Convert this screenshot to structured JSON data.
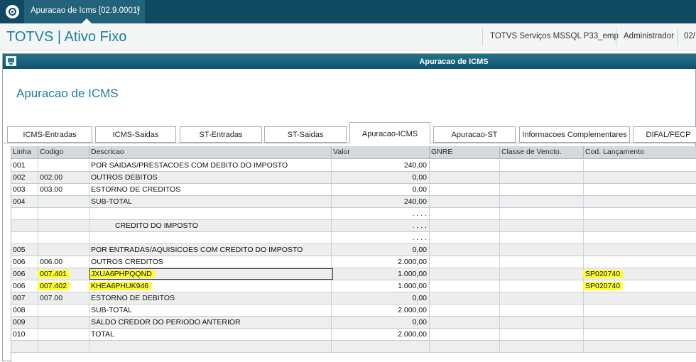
{
  "topbar": {
    "tab_title": "Apuracao de Icms [02.9.0001]",
    "tab_close": "×"
  },
  "header": {
    "app_title": "TOTVS | Ativo Fixo",
    "environment": "TOTVS Serviços MSSQL P33_emp",
    "user": "Administrador",
    "date": "02/"
  },
  "window": {
    "title": "Apuracao de ICMS",
    "page_title": "Apuracao de ICMS"
  },
  "tabs": [
    {
      "label": "ICMS-Entradas"
    },
    {
      "label": "ICMS-Saidas"
    },
    {
      "label": "ST-Entradas"
    },
    {
      "label": "ST-Saidas"
    },
    {
      "label": "Apuracao-ICMS",
      "selected": true
    },
    {
      "label": "Apuracao-ST"
    },
    {
      "label": "Informacoes Complementares"
    },
    {
      "label": "DIFAL/FECP"
    }
  ],
  "grid": {
    "columns": [
      "Linha",
      "Codigo",
      "Descricao",
      "Valor",
      "GNRE",
      "Classe de Vencto.",
      "Cod. Lançamento"
    ],
    "rows": [
      {
        "linha": "001",
        "codigo": "",
        "descricao": "POR SAIDAS/PRESTACOES COM DEBITO DO IMPOSTO",
        "valor": "240,00",
        "cod_lanc": ""
      },
      {
        "linha": "002",
        "codigo": "002.00",
        "descricao": "OUTROS DEBITOS",
        "valor": "0,00",
        "cod_lanc": ""
      },
      {
        "linha": "003",
        "codigo": "003.00",
        "descricao": "ESTORNO DE CREDITOS",
        "valor": "0,00",
        "cod_lanc": ""
      },
      {
        "linha": "004",
        "codigo": "",
        "descricao": "SUB-TOTAL",
        "valor": "240,00",
        "cod_lanc": ""
      },
      {
        "linha": "",
        "codigo": "",
        "descricao": "",
        "valor": ". . . .",
        "cod_lanc": ""
      },
      {
        "linha": "",
        "codigo": "",
        "descricao": "CREDITO DO IMPOSTO",
        "valor": ". . . .",
        "cod_lanc": "",
        "centered": true
      },
      {
        "linha": "",
        "codigo": "",
        "descricao": "",
        "valor": ". . . .",
        "cod_lanc": ""
      },
      {
        "linha": "005",
        "codigo": "",
        "descricao": "POR ENTRADAS/AQUISICOES COM CREDITO DO IMPOSTO",
        "valor": "0,00",
        "cod_lanc": ""
      },
      {
        "linha": "006",
        "codigo": "006.00",
        "descricao": "OUTROS CREDITOS",
        "valor": "2.000,00",
        "cod_lanc": ""
      },
      {
        "linha": "006",
        "codigo": "007.401",
        "descricao": "JXUA6PHPQQND",
        "valor": "1.000,00",
        "cod_lanc": "SP020740",
        "highlight": true,
        "focused": true
      },
      {
        "linha": "006",
        "codigo": "007.402",
        "descricao": "KHEA6PHUK946",
        "valor": "1.000,00",
        "cod_lanc": "SP020740",
        "highlight": true
      },
      {
        "linha": "007",
        "codigo": "007.00",
        "descricao": "ESTORNO DE DEBITOS",
        "valor": "0,00",
        "cod_lanc": ""
      },
      {
        "linha": "008",
        "codigo": "",
        "descricao": "SUB-TOTAL",
        "valor": "2.000,00",
        "cod_lanc": ""
      },
      {
        "linha": "009",
        "codigo": "",
        "descricao": "SALDO CREDOR DO PERIODO ANTERIOR",
        "valor": "0,00",
        "cod_lanc": ""
      },
      {
        "linha": "010",
        "codigo": "",
        "descricao": "TOTAL",
        "valor": "2.000,00",
        "cod_lanc": ""
      },
      {
        "linha": "",
        "codigo": "",
        "descricao": "",
        "valor": "",
        "cod_lanc": ""
      }
    ]
  },
  "colors": {
    "topbar": "#0f4a61",
    "accent": "#1b7fa0",
    "highlight": "#ffff33"
  }
}
